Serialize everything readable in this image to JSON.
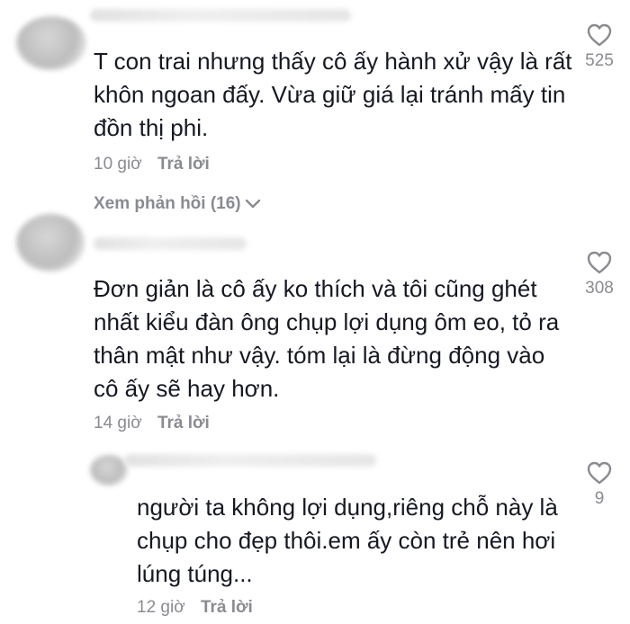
{
  "comments": [
    {
      "text": "T con trai nhưng thấy cô ấy hành xử vậy là rất\nkhôn ngoan đấy. Vừa giữ giá lại tránh mấy tin\nđồn thị phi.",
      "time": "10 giờ",
      "reply_label": "Trả lời",
      "likes": "525",
      "view_replies": "Xem phản hồi (16)"
    },
    {
      "text": "Đơn giản là cô ấy ko thích và tôi cũng ghét\nnhất kiểu đàn ông chụp lợi dụng ôm eo, tỏ ra\nthân mật như vậy. tóm lại là đừng động vào\ncô ấy sẽ hay hơn.",
      "time": "14 giờ",
      "reply_label": "Trả lời",
      "likes": "308"
    },
    {
      "text": "người ta không lợi dụng,riêng chỗ này là\nchụp cho đẹp thôi.em ấy còn trẻ nên hơi\nlúng túng...",
      "time": "12 giờ",
      "reply_label": "Trả lời",
      "likes": "9"
    }
  ],
  "icons": {
    "like": "heart-outline-icon",
    "expand": "chevron-down-icon"
  },
  "colors": {
    "text": "#161823",
    "muted": "#8a8b91"
  }
}
